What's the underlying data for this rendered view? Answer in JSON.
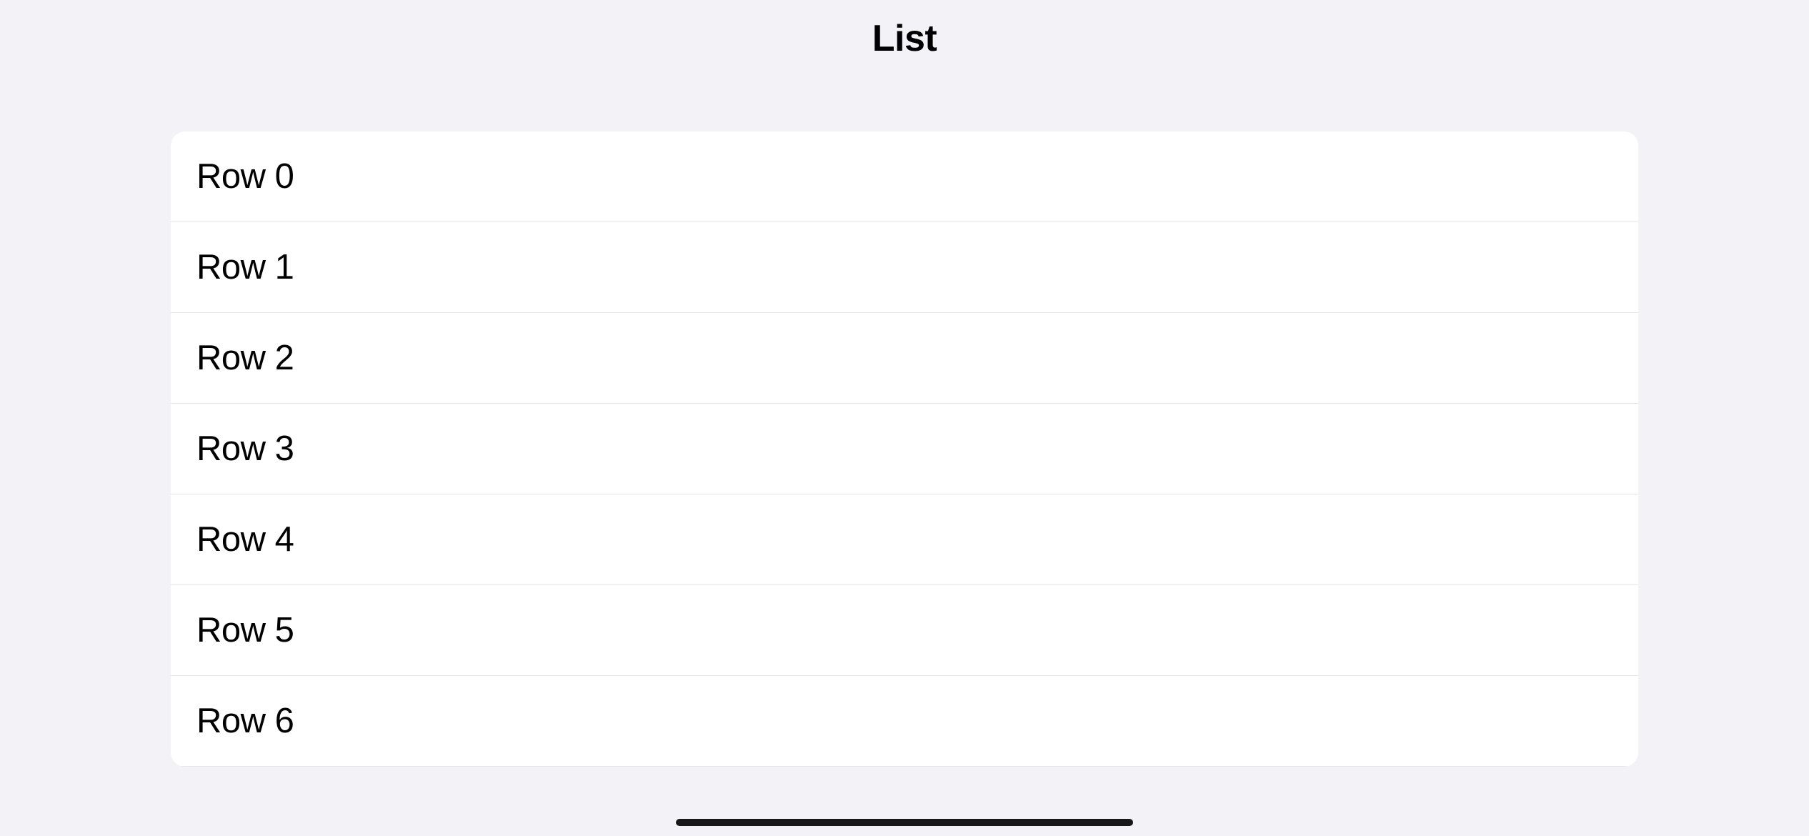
{
  "header": {
    "title": "List"
  },
  "list": {
    "rows": [
      {
        "label": "Row 0"
      },
      {
        "label": "Row 1"
      },
      {
        "label": "Row 2"
      },
      {
        "label": "Row 3"
      },
      {
        "label": "Row 4"
      },
      {
        "label": "Row 5"
      },
      {
        "label": "Row 6"
      }
    ]
  }
}
